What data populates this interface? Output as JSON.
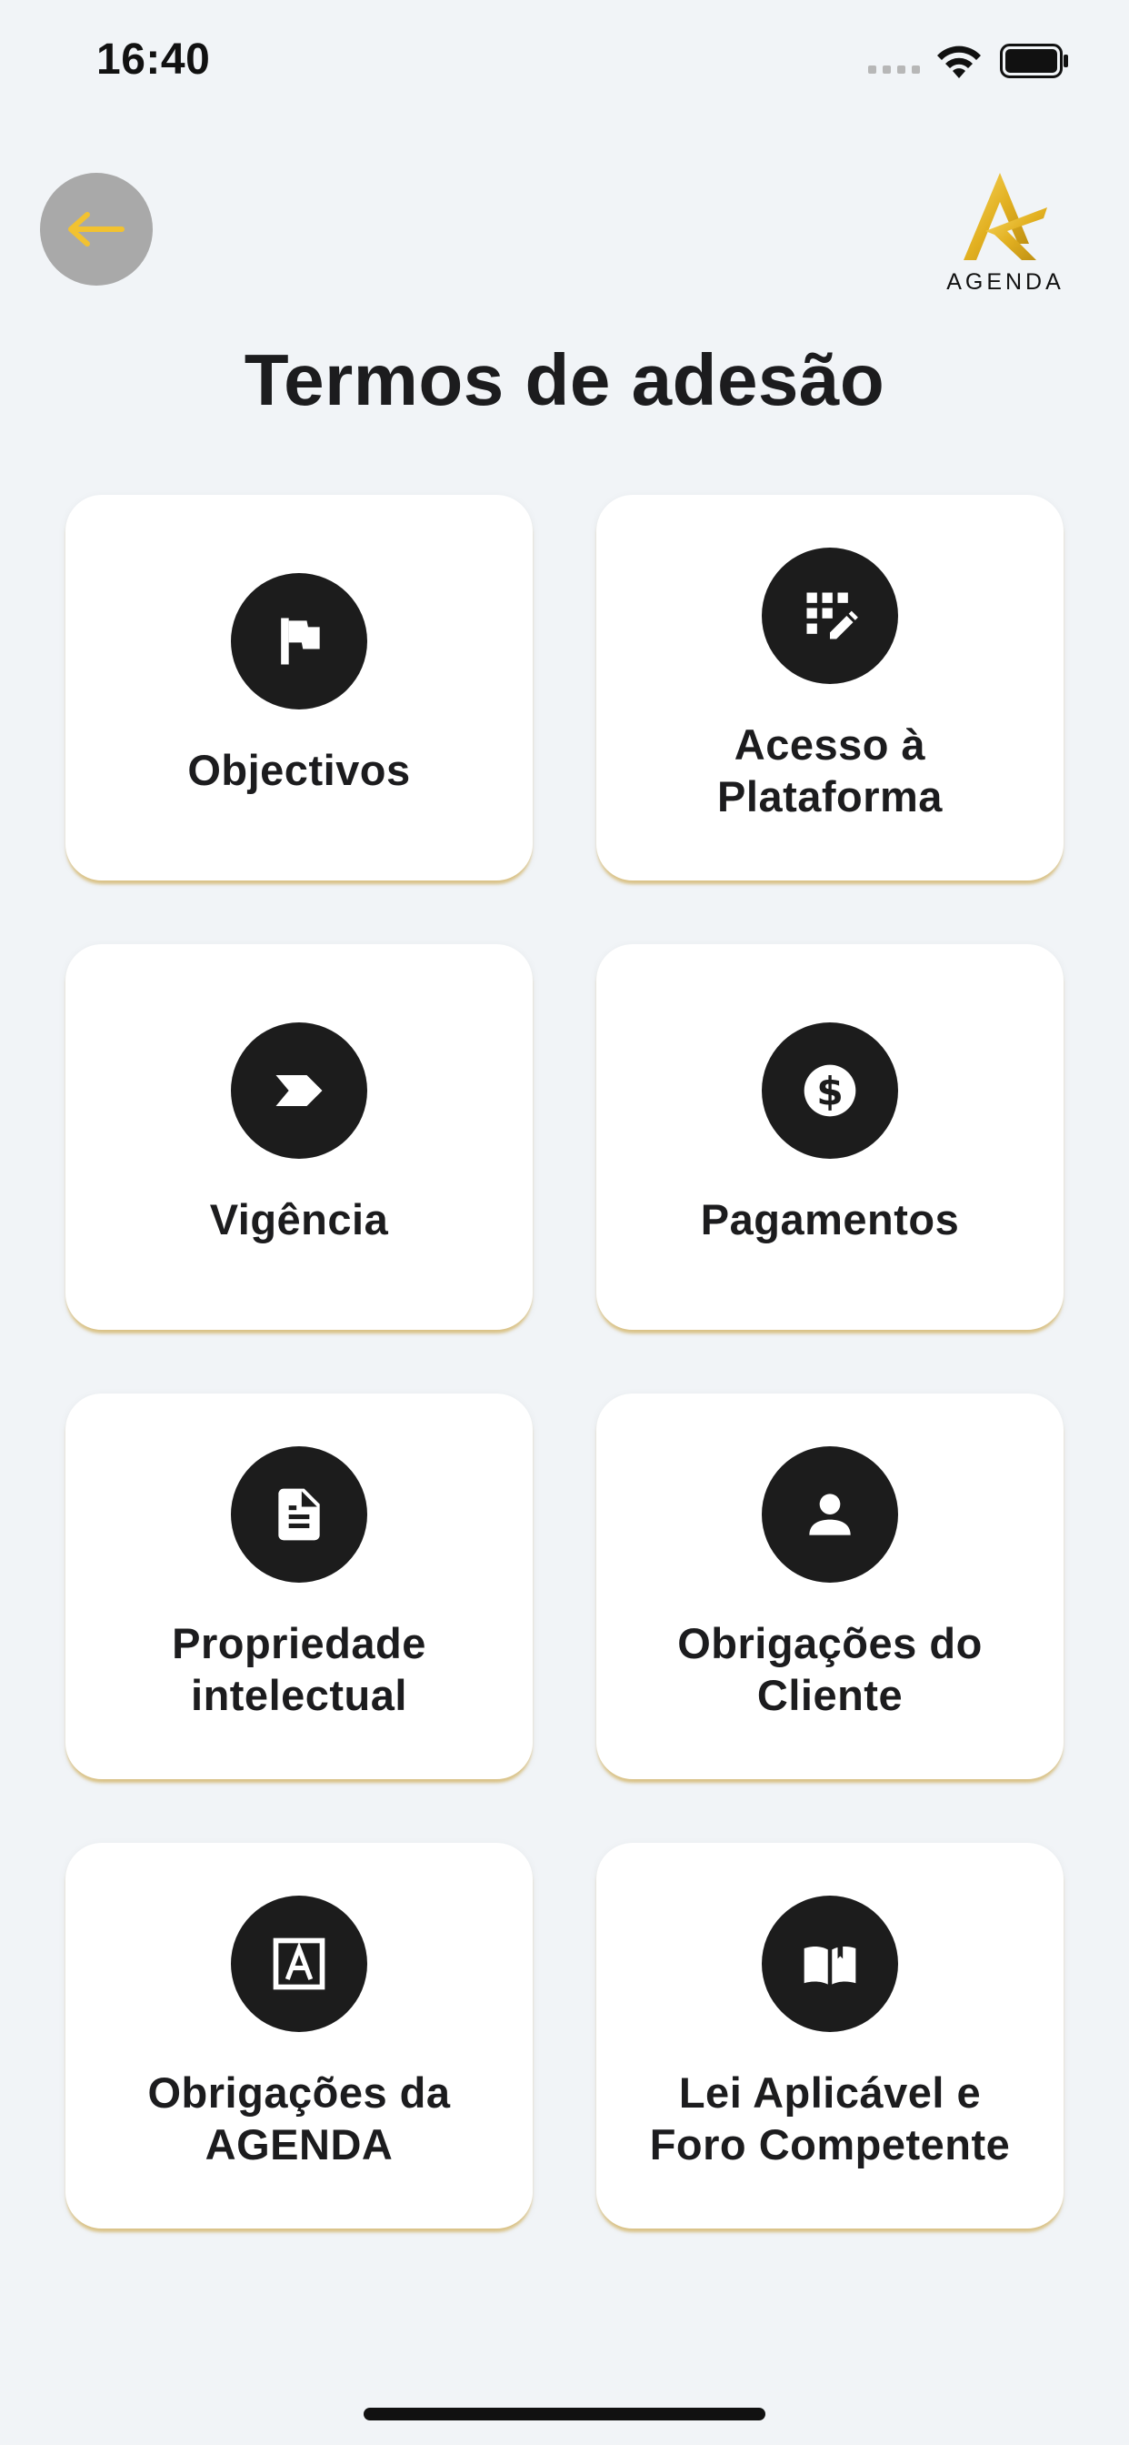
{
  "status_bar": {
    "time": "16:40"
  },
  "header": {
    "logo_text": "AGENDA",
    "title": "Termos de adesão"
  },
  "colors": {
    "accent": "#f2c230",
    "card_shadow": "#d4b464",
    "icon_bg": "#1c1c1c"
  },
  "cards": [
    {
      "label": "Objectivos",
      "icon": "flag-icon"
    },
    {
      "label": "Acesso à\nPlataforma",
      "icon": "pin-pad-edit-icon"
    },
    {
      "label": "Vigência",
      "icon": "label-arrow-icon"
    },
    {
      "label": "Pagamentos",
      "icon": "dollar-icon"
    },
    {
      "label": "Propriedade\nintelectual",
      "icon": "document-icon"
    },
    {
      "label": "Obrigações do\nCliente",
      "icon": "person-icon"
    },
    {
      "label": "Obrigações da\nAGENDA",
      "icon": "letter-a-box-icon"
    },
    {
      "label": "Lei Aplicável e\nForo Competente",
      "icon": "open-book-icon"
    }
  ]
}
